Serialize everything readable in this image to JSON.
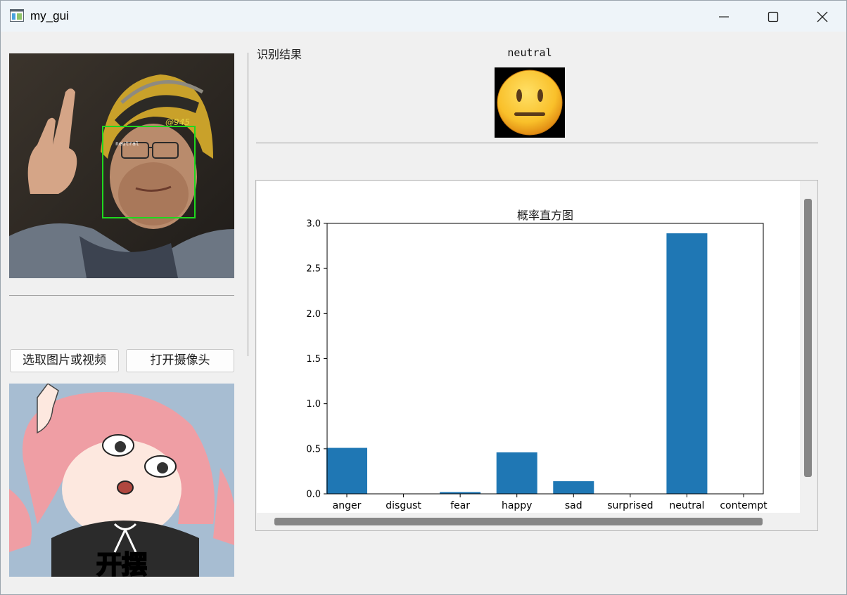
{
  "window": {
    "title": "my_gui",
    "icon": "app-window-icon",
    "controls": [
      "minimize-icon",
      "maximize-icon",
      "close-icon"
    ]
  },
  "left_panel": {
    "photo": {
      "face_label": "neutral",
      "watermark": "@945"
    },
    "buttons": {
      "select_label": "选取图片或视频",
      "camera_label": "打开摄像头"
    },
    "meme_caption": "开摆"
  },
  "result": {
    "title": "识别结果",
    "emotion": "neutral",
    "emoji_icon": "neutral-face-emoji-icon"
  },
  "chart_data": {
    "type": "bar",
    "title": "概率直方图",
    "categories": [
      "anger",
      "disgust",
      "fear",
      "happy",
      "sad",
      "surprised",
      "neutral",
      "contempt"
    ],
    "values": [
      0.51,
      0.0,
      0.02,
      0.46,
      0.14,
      0.0,
      2.89,
      0.0
    ],
    "ylim": [
      0,
      3.0
    ],
    "yticks": [
      0.0,
      0.5,
      1.0,
      1.5,
      2.0,
      2.5,
      3.0
    ],
    "ytick_labels": [
      "0.0",
      "0.5",
      "1.0",
      "1.5",
      "2.0",
      "2.5",
      "3.0"
    ],
    "xlabel": "",
    "ylabel": "",
    "bar_color": "#1f77b4",
    "grid": false,
    "legend": "none"
  }
}
